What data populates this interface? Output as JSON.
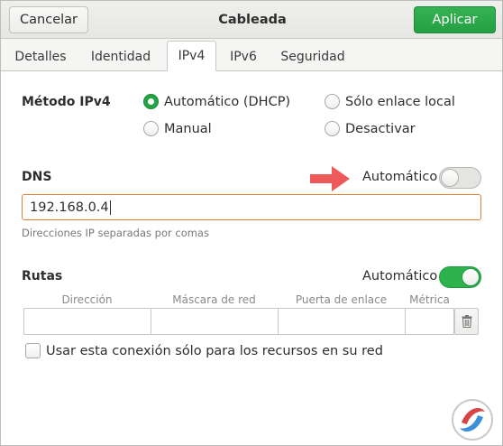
{
  "header": {
    "title": "Cableada",
    "cancel_label": "Cancelar",
    "apply_label": "Aplicar"
  },
  "tabs": [
    {
      "label": "Detalles",
      "active": false
    },
    {
      "label": "Identidad",
      "active": false
    },
    {
      "label": "IPv4",
      "active": true
    },
    {
      "label": "IPv6",
      "active": false
    },
    {
      "label": "Seguridad",
      "active": false
    }
  ],
  "ipv4": {
    "method_label": "Método IPv4",
    "options": [
      {
        "label": "Automático (DHCP)",
        "checked": true
      },
      {
        "label": "Sólo enlace local",
        "checked": false
      },
      {
        "label": "Manual",
        "checked": false
      },
      {
        "label": "Desactivar",
        "checked": false
      }
    ]
  },
  "dns": {
    "label": "DNS",
    "auto_label": "Automático",
    "auto_on": false,
    "value": "192.168.0.4",
    "hint": "Direcciones IP separadas por comas"
  },
  "routes": {
    "label": "Rutas",
    "auto_label": "Automático",
    "auto_on": true,
    "columns": [
      "Dirección",
      "Máscara de red",
      "Puerta de enlace",
      "Métrica"
    ],
    "only_local_label": "Usar esta conexión sólo para los recursos en su red",
    "only_local_checked": false
  },
  "icons": {
    "delete": "trash-icon",
    "annotation": "red-arrow-icon",
    "watermark": "logo-icon"
  },
  "colors": {
    "accent_green": "#25a244",
    "focus_orange": "#e0823a",
    "arrow_red": "#ee5a5a"
  }
}
